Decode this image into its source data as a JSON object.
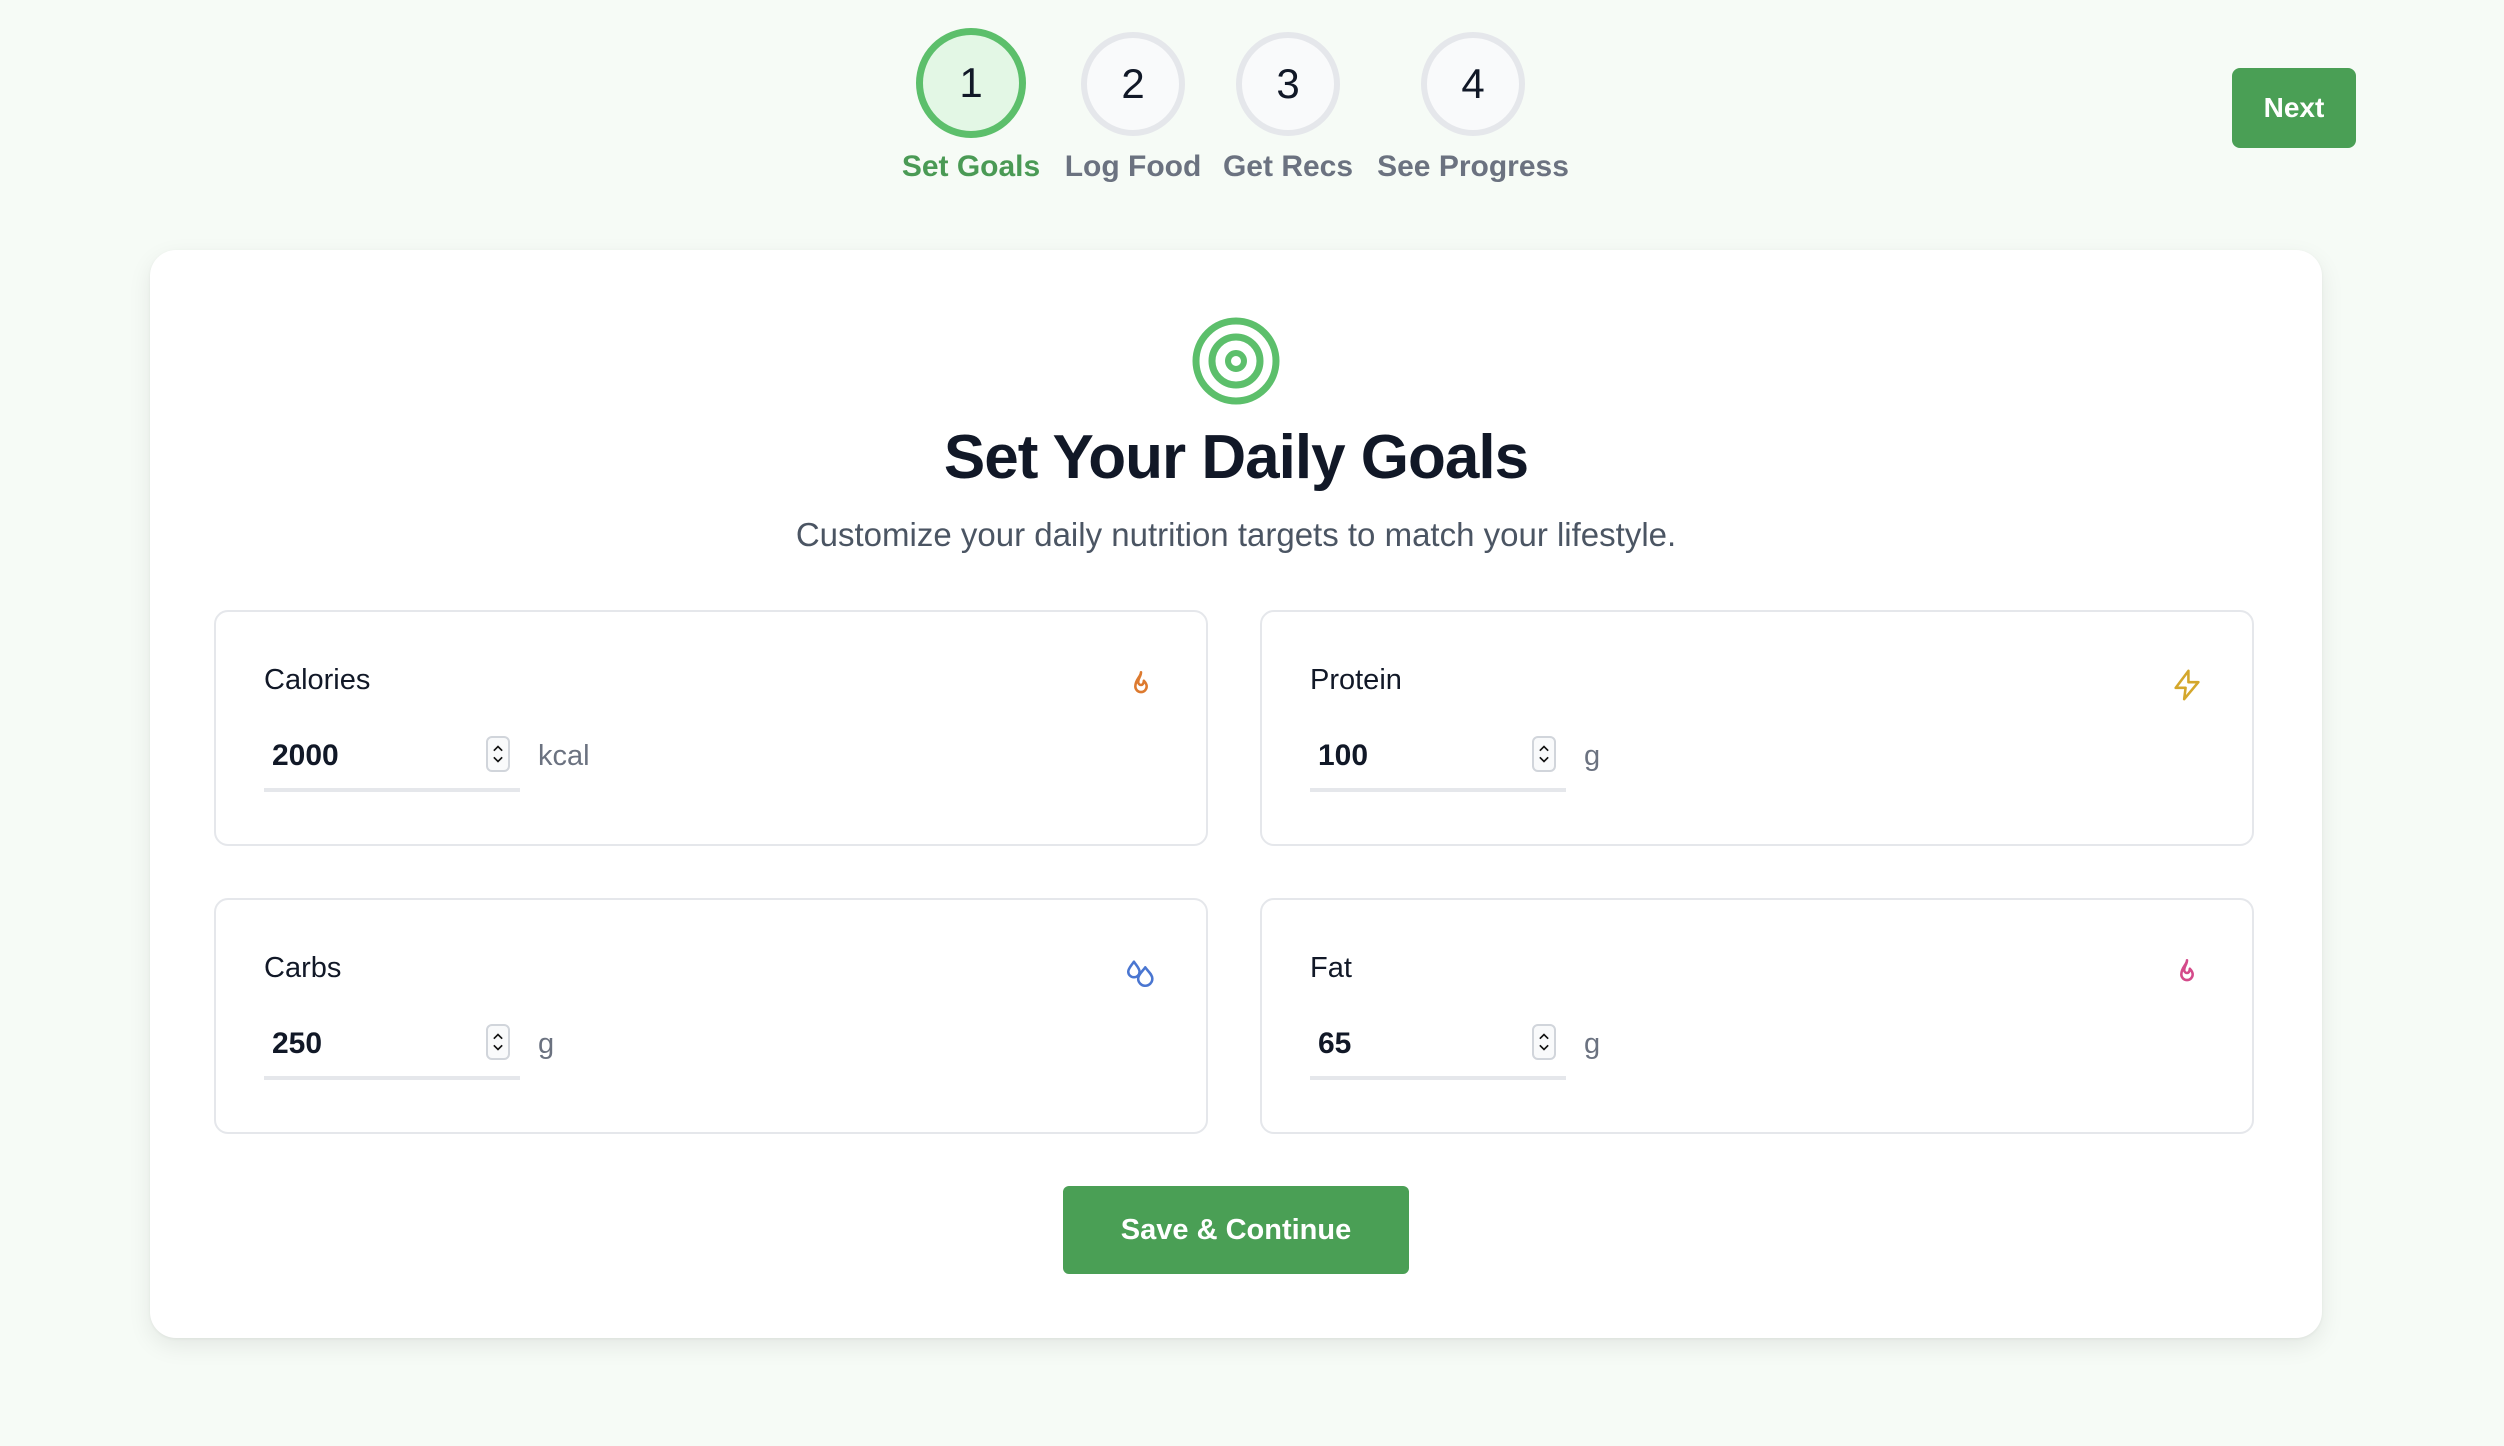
{
  "stepper": {
    "steps": [
      {
        "number": "1",
        "label": "Set Goals",
        "active": true
      },
      {
        "number": "2",
        "label": "Log Food",
        "active": false
      },
      {
        "number": "3",
        "label": "Get Recs",
        "active": false
      },
      {
        "number": "4",
        "label": "See Progress",
        "active": false
      }
    ],
    "next_label": "Next"
  },
  "card": {
    "icon": "target-icon",
    "title": "Set Your Daily Goals",
    "subtitle": "Customize your daily nutrition targets to match your lifestyle.",
    "goals": [
      {
        "label": "Calories",
        "value": "2000",
        "unit": "kcal",
        "icon": "flame-icon",
        "icon_color": "#dd7a2f"
      },
      {
        "label": "Protein",
        "value": "100",
        "unit": "g",
        "icon": "lightning-icon",
        "icon_color": "#d4a72c"
      },
      {
        "label": "Carbs",
        "value": "250",
        "unit": "g",
        "icon": "droplets-icon",
        "icon_color": "#4a76d1"
      },
      {
        "label": "Fat",
        "value": "65",
        "unit": "g",
        "icon": "flame-icon",
        "icon_color": "#d44a8a"
      }
    ],
    "save_label": "Save & Continue"
  },
  "colors": {
    "accent": "#4a9f55",
    "active_step_ring": "#5cbf6b",
    "active_step_fill": "#e3f7e5",
    "background": "#f6fbf6"
  }
}
